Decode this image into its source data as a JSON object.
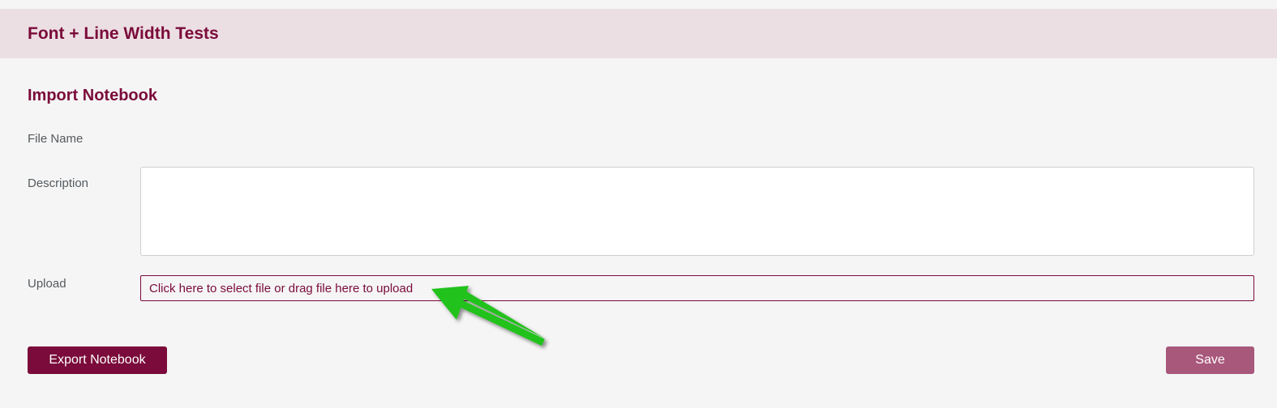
{
  "header": {
    "title": "Font + Line Width Tests"
  },
  "form": {
    "title": "Import Notebook",
    "file_name_label": "File Name",
    "description_label": "Description",
    "description_value": "",
    "upload_label": "Upload",
    "upload_prompt": "Click here to select file or drag file here to upload"
  },
  "actions": {
    "export_label": "Export Notebook",
    "save_label": "Save"
  },
  "annotation": {
    "arrow_icon": "arrow-icon",
    "arrow_color": "#22c21f"
  },
  "colors": {
    "brand": "#7a0b3a",
    "header_bg": "#ecdfe3",
    "save_disabled": "#a8587b",
    "page_bg": "#f5f5f5"
  }
}
